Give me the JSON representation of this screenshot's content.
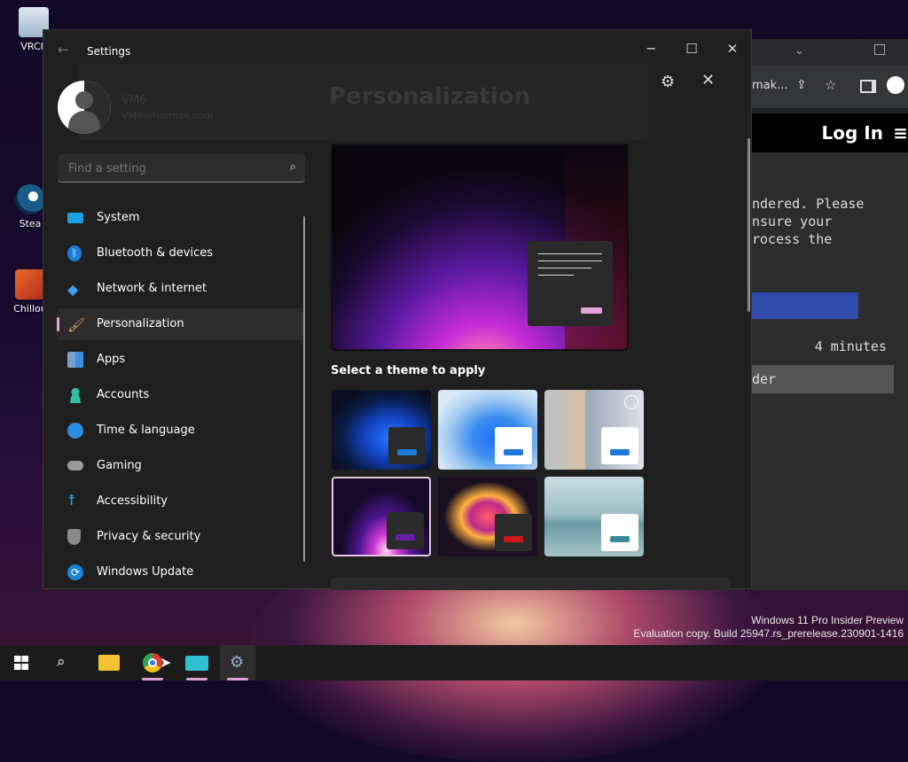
{
  "desktop": {
    "icons": [
      {
        "label": "VRCh",
        "icon": "recycle-bin-icon"
      },
      {
        "label": "Stea",
        "icon": "steam-icon"
      },
      {
        "label": "Chillou",
        "icon": "app-shortcut-icon"
      }
    ],
    "watermark_line1": "Windows 11 Pro Insider Preview",
    "watermark_line2": "Evaluation copy. Build 25947.rs_prerelease.230901-1416"
  },
  "browser": {
    "address_partial": "mak...",
    "header_button": "Log In",
    "text_lines": [
      "ndered. Please",
      "nsure your",
      "rocess the"
    ],
    "time_text": "4 minutes",
    "row_text": "der"
  },
  "settings": {
    "title": "Settings",
    "user_name": "VM6",
    "user_email": "VM6@hotmail.com",
    "search_placeholder": "Find a setting",
    "nav": [
      {
        "label": "System",
        "icon": "system-icon"
      },
      {
        "label": "Bluetooth & devices",
        "icon": "bluetooth-icon"
      },
      {
        "label": "Network & internet",
        "icon": "wifi-icon"
      },
      {
        "label": "Personalization",
        "icon": "paintbrush-icon",
        "active": true
      },
      {
        "label": "Apps",
        "icon": "apps-icon"
      },
      {
        "label": "Accounts",
        "icon": "accounts-icon"
      },
      {
        "label": "Time & language",
        "icon": "globe-clock-icon"
      },
      {
        "label": "Gaming",
        "icon": "gamepad-icon"
      },
      {
        "label": "Accessibility",
        "icon": "accessibility-icon"
      },
      {
        "label": "Privacy & security",
        "icon": "shield-icon"
      },
      {
        "label": "Windows Update",
        "icon": "update-icon"
      }
    ],
    "pane_title": "Personalization",
    "section_label": "Select a theme to apply",
    "themes": [
      {
        "name": "windows-dark",
        "selected": false
      },
      {
        "name": "windows-light",
        "selected": false
      },
      {
        "name": "spotlight",
        "selected": false
      },
      {
        "name": "glow",
        "selected": true
      },
      {
        "name": "captured-motion",
        "selected": false
      },
      {
        "name": "flow",
        "selected": false
      }
    ]
  },
  "colors": {
    "accent": "#e8a6d8",
    "window_bg": "#202020",
    "nav_active_bg": "#2d2d2d"
  },
  "taskbar": {
    "items": [
      "start-icon",
      "search-icon",
      "file-explorer-icon",
      "chrome-icon",
      "screen-app-icon",
      "settings-icon"
    ]
  }
}
